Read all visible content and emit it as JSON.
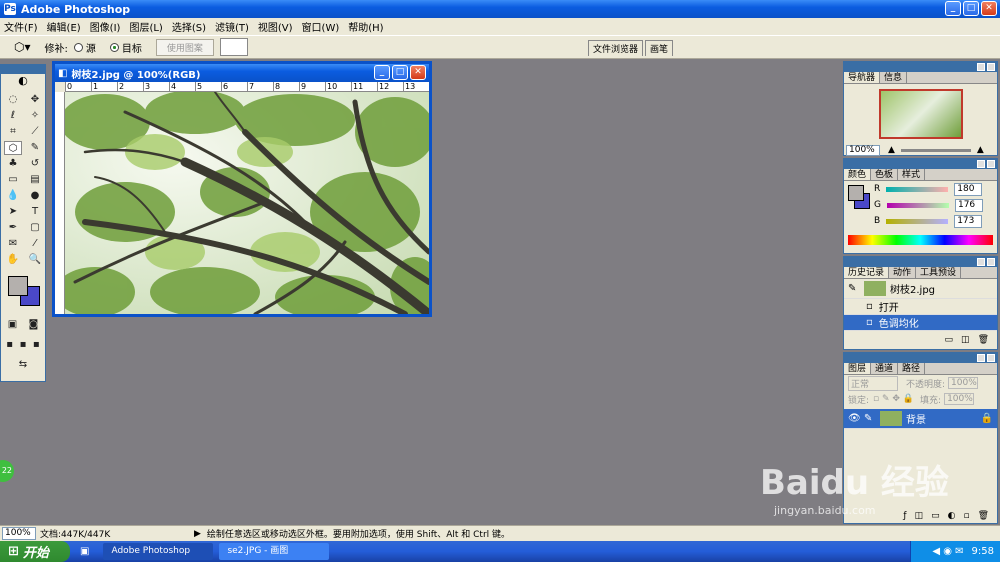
{
  "app": {
    "title": "Adobe Photoshop"
  },
  "menu": [
    "文件(F)",
    "编辑(E)",
    "图像(I)",
    "图层(L)",
    "选择(S)",
    "滤镜(T)",
    "视图(V)",
    "窗口(W)",
    "帮助(H)"
  ],
  "options": {
    "patch_label": "修补:",
    "source": "源",
    "destination": "目标",
    "use_pattern": "使用图案"
  },
  "wells": [
    "文件浏览器",
    "画笔"
  ],
  "document": {
    "title": "树枝2.jpg @ 100%(RGB)",
    "ruler_ticks": [
      "0",
      "1",
      "2",
      "3",
      "4",
      "5",
      "6",
      "7",
      "8",
      "9",
      "10",
      "11",
      "12",
      "13"
    ]
  },
  "navigator": {
    "tabs": [
      "导航器",
      "信息"
    ],
    "zoom": "100%"
  },
  "color": {
    "tabs": [
      "颜色",
      "色板",
      "样式"
    ],
    "r_label": "R",
    "g_label": "G",
    "b_label": "B",
    "r": "180",
    "g": "176",
    "b": "173",
    "fg": "#b4b0ad",
    "bg": "#4a48c8"
  },
  "history": {
    "tabs": [
      "历史记录",
      "动作",
      "工具预设"
    ],
    "snapshot": "树枝2.jpg",
    "items": [
      "打开",
      "色调均化"
    ]
  },
  "layers": {
    "tabs": [
      "图层",
      "通道",
      "路径"
    ],
    "mode": "正常",
    "opacity_label": "不透明度:",
    "opacity": "100%",
    "lock_label": "锁定:",
    "fill_label": "填充:",
    "fill": "100%",
    "layer_name": "背景"
  },
  "status": {
    "zoom": "100%",
    "doc": "文档:447K/447K",
    "hint": "绘制任意选区或移动选区外框。要用附加选项，使用 Shift、Alt 和 Ctrl 键。"
  },
  "taskbar": {
    "start": "开始",
    "tasks": [
      "Adobe Photoshop",
      "se2.JPG - 画图"
    ],
    "time": "9:58"
  },
  "watermark": {
    "big": "Baidu 经验",
    "small": "jingyan.baidu.com"
  },
  "badge": "22"
}
